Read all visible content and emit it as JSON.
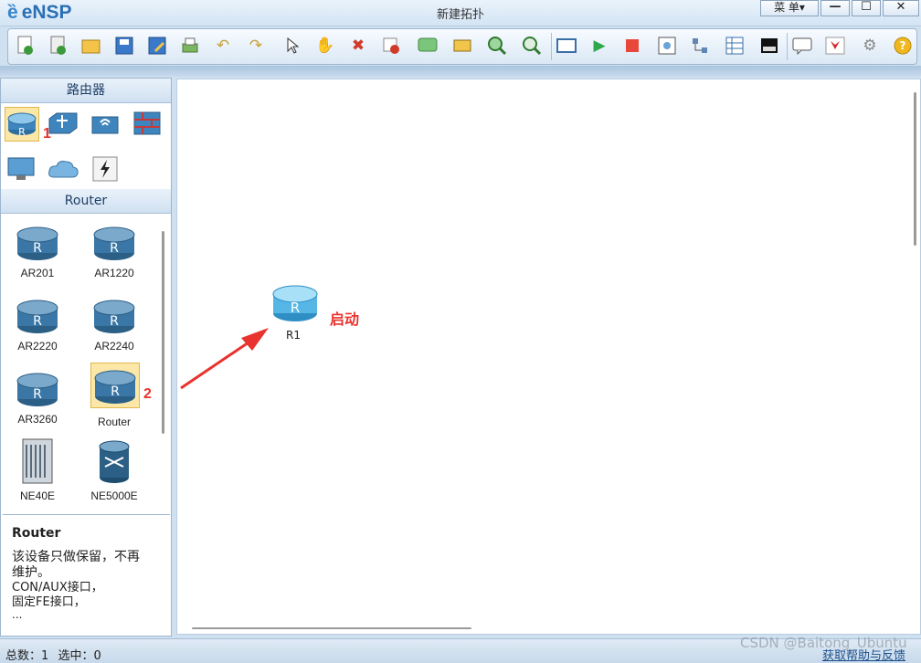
{
  "app": {
    "logo_text": "eNSP",
    "window_title": "新建拓扑",
    "menu_label": "菜 单▾"
  },
  "window_controls": {
    "minimize": "—",
    "maximize": "☐",
    "close": "✕"
  },
  "toolbar": {
    "icons": [
      "new-topology",
      "new-label",
      "open",
      "save",
      "save-as",
      "print",
      "undo",
      "redo",
      "select",
      "pan",
      "delete",
      "delete-link",
      "text",
      "rectangle",
      "zoom-in",
      "zoom-out",
      "zoom-reset",
      "start-device",
      "stop-device",
      "capture",
      "topology-view",
      "table-view",
      "terminal",
      "message",
      "huawei-logo",
      "settings",
      "help"
    ]
  },
  "left_panel": {
    "category_title": "路由器",
    "device_types": [
      "router",
      "switch",
      "wireless",
      "firewall",
      "pc",
      "cloud",
      "other-device"
    ],
    "series_title": "Router",
    "devices": [
      {
        "label": "AR201"
      },
      {
        "label": "AR1220"
      },
      {
        "label": "AR2220"
      },
      {
        "label": "AR2240"
      },
      {
        "label": "AR3260"
      },
      {
        "label": "Router"
      },
      {
        "label": "NE40E"
      },
      {
        "label": "NE5000E"
      }
    ],
    "info": {
      "title": "Router",
      "desc1": "该设备只做保留，不再",
      "desc2": "维护。",
      "desc3": "CON/AUX接口，",
      "desc4": "固定FE接口，",
      "desc5": "..."
    }
  },
  "annotations": {
    "marker1": "1",
    "marker2": "2",
    "start_label": "启动"
  },
  "canvas": {
    "device_label": "R1"
  },
  "status": {
    "total_label": "总数：",
    "total_value": "1",
    "selected_label": "选中：",
    "selected_value": "0",
    "help_link": "获取帮助与反馈",
    "watermark": "CSDN @Baitong_Ubuntu"
  },
  "colors": {
    "accent": "#2a6fb5",
    "marker": "#e8332e",
    "router_blue": "#2f6fa0",
    "router_light": "#5fc2ea"
  }
}
